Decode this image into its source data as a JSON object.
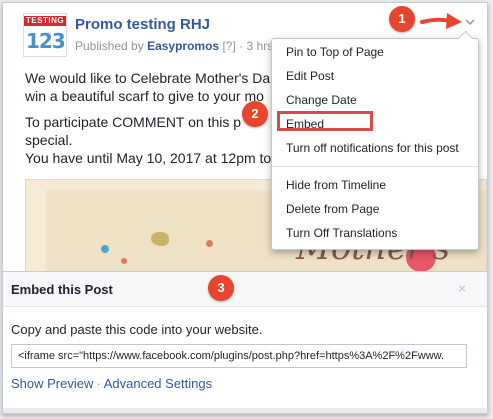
{
  "post": {
    "logo_top": "TESTING",
    "logo_number": "123",
    "page_name": "Promo testing RHJ",
    "published_by_prefix": "Published by",
    "publisher": "Easypromos",
    "meta_suffix": "[?] · 3 hrs ·",
    "paragraphs": [
      "We would like to Celebrate Mother's Da",
      "win a beautiful scarf to give to your mo",
      "To participate COMMENT on this p",
      "special.",
      "You have until May 10, 2017 at 12pm to"
    ],
    "image_text": "Mother's"
  },
  "menu": {
    "items": [
      "Pin to Top of Page",
      "Edit Post",
      "Change Date",
      "Embed",
      "Turn off notifications for this post",
      "Hide from Timeline",
      "Delete from Page",
      "Turn Off Translations"
    ]
  },
  "callouts": [
    "1",
    "2",
    "3"
  ],
  "embed": {
    "title": "Embed this Post",
    "close_glyph": "×",
    "instruction": "Copy and paste this code into your website.",
    "code": "<iframe src=\"https://www.facebook.com/plugins/post.php?href=https%3A%2F%2Fwww.",
    "show_preview": "Show Preview",
    "separator": "·",
    "advanced_settings": "Advanced Settings"
  },
  "colors": {
    "link": "#365899",
    "callout": "#e8452f",
    "highlight": "#d94b4b"
  }
}
